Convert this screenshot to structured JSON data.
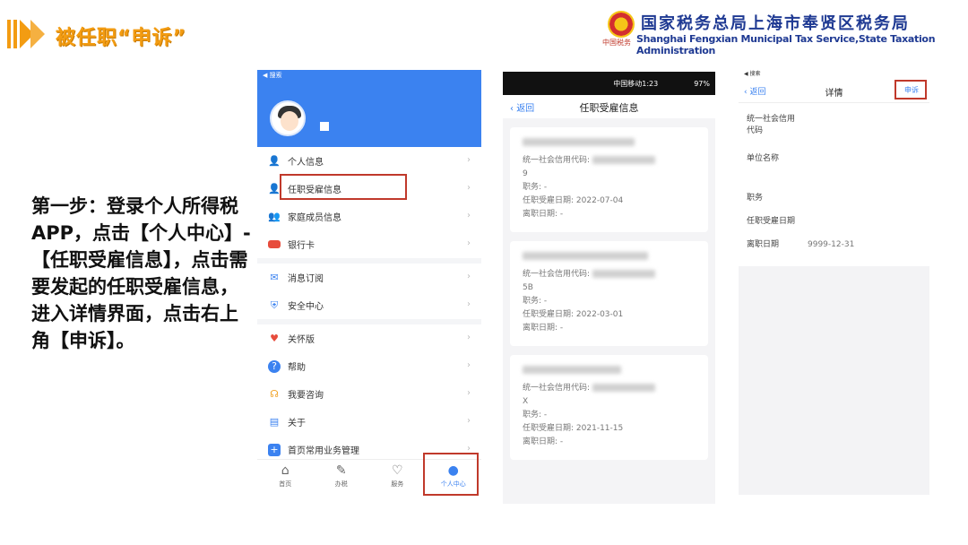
{
  "header": {
    "title": "被任职“申诉”",
    "bureau_cn": "国家税务总局上海市奉贤区税务局",
    "bureau_en": "Shanghai Fengxian Municipal Tax Service,State Taxation Administration",
    "logo_sub": "中国税务"
  },
  "instruction": "第一步：登录个人所得税APP，点击【个人中心】-【任职受雇信息】，点击需要发起的任职受雇信息，进入详情界面，点击右上角【申诉】。",
  "phone1": {
    "status": "◀ 搜索",
    "menu": [
      {
        "icon": "user-icon",
        "label": "个人信息"
      },
      {
        "icon": "employment-icon",
        "label": "任职受雇信息"
      },
      {
        "icon": "family-icon",
        "label": "家庭成员信息"
      },
      {
        "icon": "card-icon",
        "label": "银行卡"
      },
      {
        "icon": "mail-icon",
        "label": "消息订阅"
      },
      {
        "icon": "shield-icon",
        "label": "安全中心"
      },
      {
        "icon": "heart-icon",
        "label": "关怀版"
      },
      {
        "icon": "help-icon",
        "label": "帮助"
      },
      {
        "icon": "headset-icon",
        "label": "我要咨询"
      },
      {
        "icon": "doc-icon",
        "label": "关于"
      },
      {
        "icon": "plus-icon",
        "label": "首页常用业务管理"
      }
    ],
    "tabs": [
      "首页",
      "办税",
      "服务",
      "个人中心"
    ]
  },
  "phone2": {
    "status_carrier": "中国移动1:23",
    "status_right": "97%",
    "back": "返回",
    "title": "任职受雇信息",
    "cards": [
      {
        "code_label": "统一社会信用代码:",
        "code_tail": "9",
        "post_label": "职务:",
        "post": "-",
        "hire_label": "任职受雇日期:",
        "hire": "2022-07-04",
        "leave_label": "离职日期:",
        "leave": "-"
      },
      {
        "code_label": "统一社会信用代码:",
        "code_tail": "5B",
        "post_label": "职务:",
        "post": "-",
        "hire_label": "任职受雇日期:",
        "hire": "2022-03-01",
        "leave_label": "离职日期:",
        "leave": "-"
      },
      {
        "code_label": "统一社会信用代码:",
        "code_tail": "X",
        "post_label": "职务:",
        "post": "-",
        "hire_label": "任职受雇日期:",
        "hire": "2021-11-15",
        "leave_label": "离职日期:",
        "leave": "-"
      }
    ]
  },
  "phone3": {
    "status": "◀ 搜索",
    "back": "返回",
    "title": "详情",
    "appeal": "申诉",
    "fields": [
      {
        "k": "统一社会信用代码",
        "v": ""
      },
      {
        "k": "单位名称",
        "v": ""
      },
      {
        "k": "职务",
        "v": ""
      },
      {
        "k": "任职受雇日期",
        "v": ""
      },
      {
        "k": "离职日期",
        "v": "9999-12-31"
      }
    ]
  },
  "colors": {
    "accent": "#3b82f0",
    "highlight": "#c0392b",
    "title": "#f39c12"
  }
}
